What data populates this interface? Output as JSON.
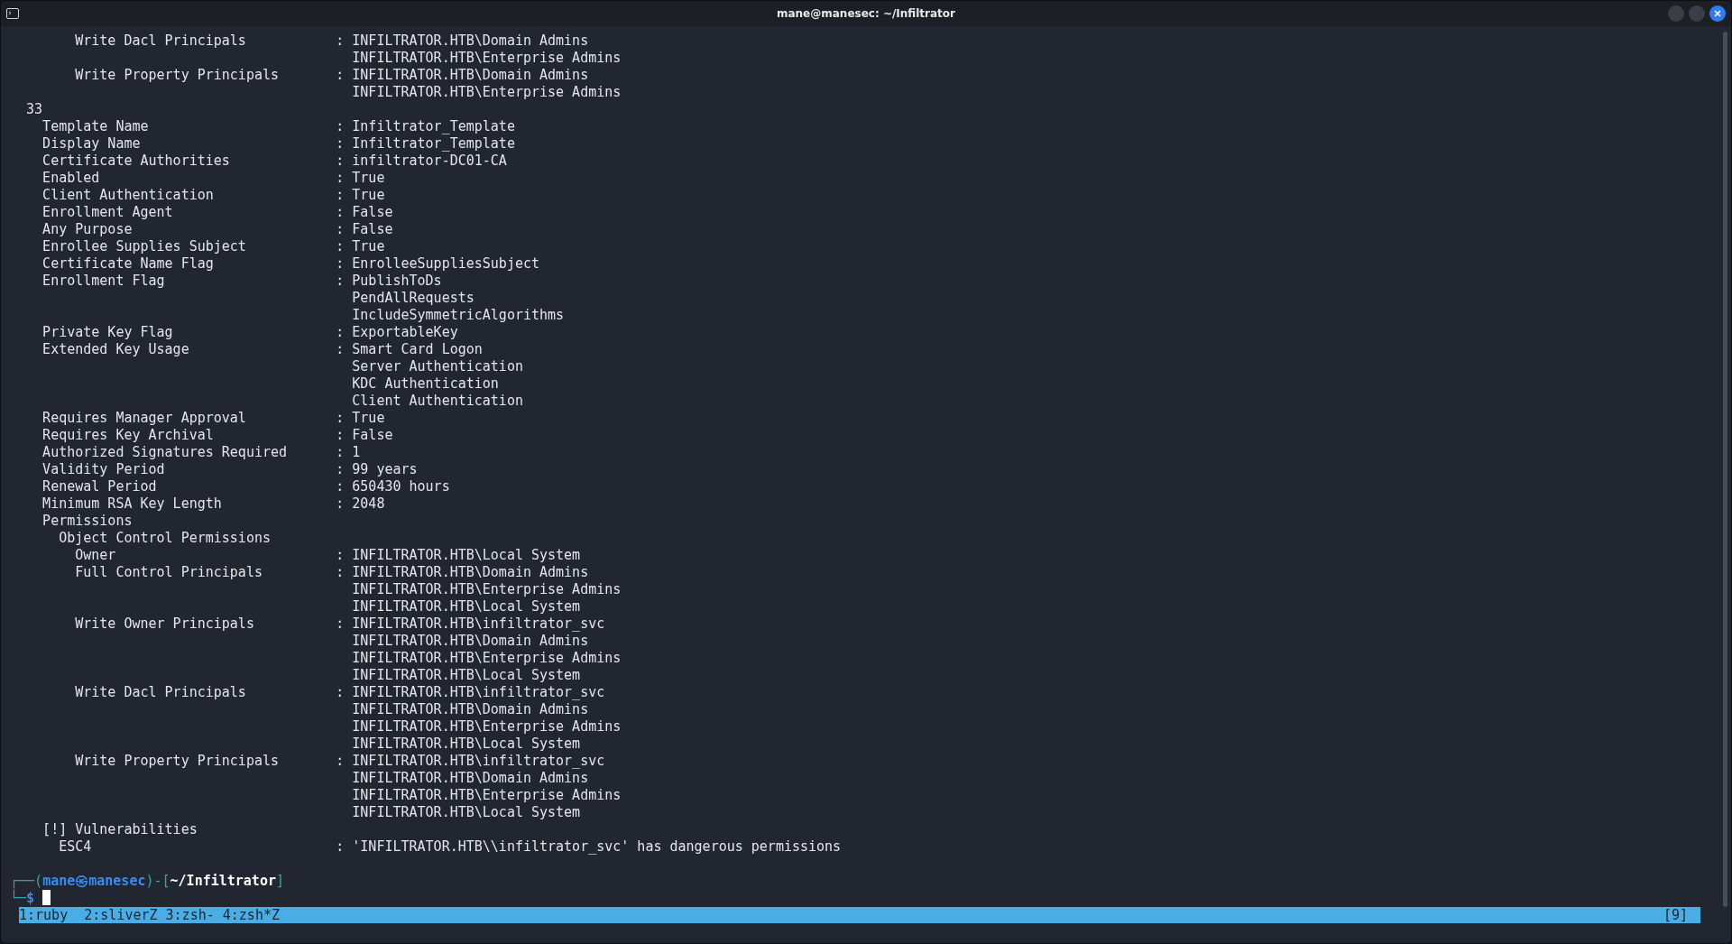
{
  "window": {
    "title": "mane@manesec: ~/Infiltrator"
  },
  "terminal": {
    "lines": [
      "        Write Dacl Principals           : INFILTRATOR.HTB\\Domain Admins",
      "                                          INFILTRATOR.HTB\\Enterprise Admins",
      "        Write Property Principals       : INFILTRATOR.HTB\\Domain Admins",
      "                                          INFILTRATOR.HTB\\Enterprise Admins",
      "  33",
      "    Template Name                       : Infiltrator_Template",
      "    Display Name                        : Infiltrator_Template",
      "    Certificate Authorities             : infiltrator-DC01-CA",
      "    Enabled                             : True",
      "    Client Authentication               : True",
      "    Enrollment Agent                    : False",
      "    Any Purpose                         : False",
      "    Enrollee Supplies Subject           : True",
      "    Certificate Name Flag               : EnrolleeSuppliesSubject",
      "    Enrollment Flag                     : PublishToDs",
      "                                          PendAllRequests",
      "                                          IncludeSymmetricAlgorithms",
      "    Private Key Flag                    : ExportableKey",
      "    Extended Key Usage                  : Smart Card Logon",
      "                                          Server Authentication",
      "                                          KDC Authentication",
      "                                          Client Authentication",
      "    Requires Manager Approval           : True",
      "    Requires Key Archival               : False",
      "    Authorized Signatures Required      : 1",
      "    Validity Period                     : 99 years",
      "    Renewal Period                      : 650430 hours",
      "    Minimum RSA Key Length              : 2048",
      "    Permissions",
      "      Object Control Permissions",
      "        Owner                           : INFILTRATOR.HTB\\Local System",
      "        Full Control Principals         : INFILTRATOR.HTB\\Domain Admins",
      "                                          INFILTRATOR.HTB\\Enterprise Admins",
      "                                          INFILTRATOR.HTB\\Local System",
      "        Write Owner Principals          : INFILTRATOR.HTB\\infiltrator_svc",
      "                                          INFILTRATOR.HTB\\Domain Admins",
      "                                          INFILTRATOR.HTB\\Enterprise Admins",
      "                                          INFILTRATOR.HTB\\Local System",
      "        Write Dacl Principals           : INFILTRATOR.HTB\\infiltrator_svc",
      "                                          INFILTRATOR.HTB\\Domain Admins",
      "                                          INFILTRATOR.HTB\\Enterprise Admins",
      "                                          INFILTRATOR.HTB\\Local System",
      "        Write Property Principals       : INFILTRATOR.HTB\\infiltrator_svc",
      "                                          INFILTRATOR.HTB\\Domain Admins",
      "                                          INFILTRATOR.HTB\\Enterprise Admins",
      "                                          INFILTRATOR.HTB\\Local System",
      "    [!] Vulnerabilities",
      "      ESC4                              : 'INFILTRATOR.HTB\\\\infiltrator_svc' has dangerous permissions"
    ],
    "prompt": {
      "open": "┌──(",
      "user": "mane",
      "at": "㉿",
      "host": "manesec",
      "sep": ")-[",
      "path": "~/Infiltrator",
      "close": "]",
      "corner": "└─",
      "sign": "$"
    }
  },
  "status_bar": {
    "windows": "1:ruby  2:sliverZ 3:zsh- 4:zsh*Z",
    "right": "[9]"
  }
}
